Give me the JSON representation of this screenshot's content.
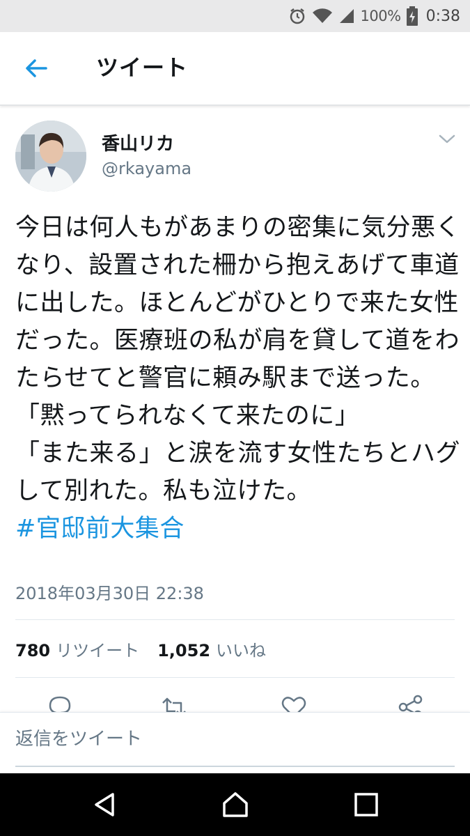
{
  "status_bar": {
    "battery_percent": "100%",
    "time": "0:38",
    "icons": [
      "alarm-icon",
      "wifi-icon",
      "cell-signal-icon",
      "battery-charging-icon"
    ]
  },
  "header": {
    "title": "ツイート",
    "back_icon": "back-arrow-icon"
  },
  "tweet": {
    "author_name": "香山リカ",
    "author_handle": "@rkayama",
    "text": "今日は何人もがあまりの密集に気分悪くなり、設置された柵から抱えあげて車道に出した。ほとんどがひとりで来た女性だった。医療班の私が肩を貸して道をわたらせてと警官に頼み駅まで送った。\n「黙ってられなくて来たのに」\n「また来る」と涙を流す女性たちとハグして別れた。私も泣けた。",
    "hashtag": "#官邸前大集合",
    "timestamp": "2018年03月30日 22:38",
    "retweet_count": "780",
    "retweet_label": "リツイート",
    "like_count": "1,052",
    "like_label": "いいね"
  },
  "actions": [
    "reply-icon",
    "retweet-icon",
    "like-icon",
    "share-icon"
  ],
  "reply_box": {
    "placeholder": "返信をツイート"
  },
  "nav_bar": [
    "nav-back-icon",
    "nav-home-icon",
    "nav-recents-icon"
  ],
  "colors": {
    "accent": "#1b95e0",
    "text": "#14171a",
    "secondary": "#657786",
    "status_bar_bg": "#e9e9ea"
  }
}
